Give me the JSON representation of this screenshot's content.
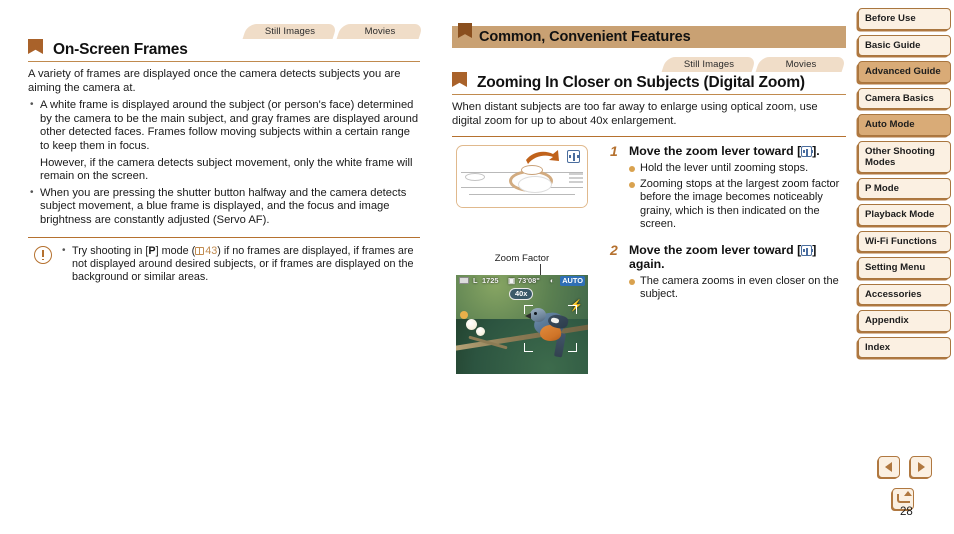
{
  "page_number": "28",
  "colors": {
    "accent_brown": "#b5712f",
    "flag_brown": "#a9622a",
    "chapter_banner": "#c9a173",
    "tab_bg": "#f0ddc8",
    "nav_light": "#fbf0e2",
    "nav_dark": "#d9ab77",
    "bullet_orange": "#d9a24f"
  },
  "left_column": {
    "tabs": [
      {
        "label": "Still Images"
      },
      {
        "label": "Movies"
      }
    ],
    "heading": "On-Screen Frames",
    "intro": "A variety of frames are displayed once the camera detects subjects you are aiming the camera at.",
    "bullets": [
      {
        "bulleted": true,
        "text": "A white frame is displayed around the subject (or person's face) determined by the camera to be the main subject, and gray frames are displayed around other detected faces. Frames follow moving subjects within a certain range to keep them in focus."
      },
      {
        "bulleted": false,
        "text": "However, if the camera detects subject movement, only the white frame will remain on the screen."
      },
      {
        "bulleted": true,
        "text": "When you are pressing the shutter button halfway and the camera detects subject movement, a blue frame is displayed, and the focus and image brightness are constantly adjusted (Servo AF)."
      }
    ],
    "note": {
      "icon": "caution-icon",
      "text_before": "Try shooting in [",
      "mode_key": "P",
      "text_mid": "] mode (",
      "page_ref": "43",
      "text_after": ") if no frames are displayed, if frames are not displayed around desired subjects, or if frames are displayed on the background or similar areas."
    }
  },
  "middle_column": {
    "chapter_title": "Common, Convenient Features",
    "tabs": [
      {
        "label": "Still Images"
      },
      {
        "label": "Movies"
      }
    ],
    "heading": "Zooming In Closer on Subjects (Digital Zoom)",
    "intro": "When distant subjects are too far away to enlarge using optical zoom, use digital zoom for up to about 40x enlargement.",
    "figure_caption": "Zoom Factor",
    "lcd": {
      "quality": "L",
      "shots_remaining": "1725",
      "movie_time": "73'08\"",
      "mode_badge": "AUTO",
      "zoom_factor_badge": "40x",
      "flash_mode": "A",
      "icons": [
        "battery-icon",
        "image-quality-icon",
        "movie-icon",
        "image-stabilizer-icon",
        "flash-auto-icon"
      ]
    },
    "steps": [
      {
        "number": "1",
        "title_before": "Move the zoom lever toward [",
        "title_icon": "telephoto-icon",
        "title_after": "].",
        "bullets": [
          "Hold the lever until zooming stops.",
          "Zooming stops at the largest zoom factor before the image becomes noticeably grainy, which is then indicated on the screen."
        ]
      },
      {
        "number": "2",
        "title_before": "Move the zoom lever toward [",
        "title_icon": "telephoto-icon",
        "title_after": "] again.",
        "bullets": [
          "The camera zooms in even closer on the subject."
        ]
      }
    ]
  },
  "sidebar": {
    "items": [
      {
        "label": "Before Use",
        "style": "light",
        "lines": 1
      },
      {
        "label": "Basic Guide",
        "style": "light",
        "lines": 1
      },
      {
        "label": "Advanced Guide",
        "style": "dark",
        "lines": 1
      },
      {
        "label": "Camera Basics",
        "style": "light",
        "lines": 1
      },
      {
        "label": "Auto Mode",
        "style": "dark",
        "lines": 1
      },
      {
        "label": "Other Shooting Modes",
        "style": "light",
        "lines": 2
      },
      {
        "label": "P Mode",
        "style": "light",
        "lines": 1
      },
      {
        "label": "Playback Mode",
        "style": "light",
        "lines": 1
      },
      {
        "label": "Wi-Fi Functions",
        "style": "light",
        "lines": 1
      },
      {
        "label": "Setting Menu",
        "style": "light",
        "lines": 1
      },
      {
        "label": "Accessories",
        "style": "light",
        "lines": 1
      },
      {
        "label": "Appendix",
        "style": "light",
        "lines": 1
      },
      {
        "label": "Index",
        "style": "light",
        "lines": 1
      }
    ]
  },
  "pager": {
    "prev": "previous-page",
    "next": "next-page",
    "back": "back"
  }
}
